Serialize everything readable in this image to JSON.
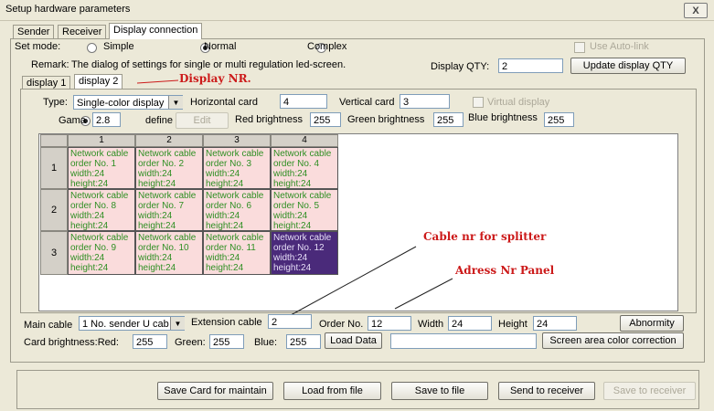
{
  "window": {
    "title": "Setup hardware parameters",
    "close": "X"
  },
  "tabs": [
    {
      "label": "Sender"
    },
    {
      "label": "Receiver"
    },
    {
      "label": "Display connection"
    }
  ],
  "set_mode": {
    "label": "Set mode:",
    "options": [
      {
        "label": "Simple",
        "selected": false
      },
      {
        "label": "Normal",
        "selected": true
      },
      {
        "label": "Complex",
        "selected": false
      }
    ],
    "auto_link": "Use Auto-link"
  },
  "remark": {
    "label": "Remark:",
    "text": "The dialog of settings for single or multi  regulation led-screen."
  },
  "display_qty": {
    "label": "Display QTY:",
    "value": "2",
    "update_button": "Update display QTY"
  },
  "display_tabs": [
    {
      "label": "display 1"
    },
    {
      "label": "display 2"
    }
  ],
  "config": {
    "type_label": "Type:",
    "type_value": "Single-color display",
    "horizontal_label": "Horizontal card",
    "horizontal_value": "4",
    "vertical_label": "Vertical card",
    "vertical_value": "3",
    "virtual_label": "Virtual display",
    "gama_label": "Gama",
    "gama_value": "2.8",
    "define_label": "define",
    "edit_label": "Edit",
    "red_label": "Red brightness",
    "red_value": "255",
    "green_label": "Green brightness",
    "green_value": "255",
    "blue_label": "Blue brightness",
    "blue_value": "255"
  },
  "grid": {
    "col_headers": [
      "1",
      "2",
      "3",
      "4"
    ],
    "row_headers": [
      "1",
      "2",
      "3"
    ],
    "rows": [
      [
        [
          "Network cable",
          "order No. 1",
          "width:24",
          "height:24"
        ],
        [
          "Network cable",
          "order No. 2",
          "width:24",
          "height:24"
        ],
        [
          "Network cable",
          "order No. 3",
          "width:24",
          "height:24"
        ],
        [
          "Network cable",
          "order No. 4",
          "width:24",
          "height:24"
        ]
      ],
      [
        [
          "Network cable",
          "order No. 8",
          "width:24",
          "height:24"
        ],
        [
          "Network cable",
          "order No. 7",
          "width:24",
          "height:24"
        ],
        [
          "Network cable",
          "order No. 6",
          "width:24",
          "height:24"
        ],
        [
          "Network cable",
          "order No. 5",
          "width:24",
          "height:24"
        ]
      ],
      [
        [
          "Network cable",
          "order No. 9",
          "width:24",
          "height:24"
        ],
        [
          "Network cable",
          "order No. 10",
          "width:24",
          "height:24"
        ],
        [
          "Network cable",
          "order No. 11",
          "width:24",
          "height:24"
        ],
        [
          "Network cable",
          "order No. 12",
          "width:24",
          "height:24"
        ]
      ]
    ]
  },
  "annotations": {
    "display_nr": "Display NR.",
    "cable_nr": "Cable nr for splitter",
    "adress_nr": "Adress Nr Panel"
  },
  "cable": {
    "main_label": "Main cable",
    "main_value": "1 No. sender U cab",
    "extension_label": "Extension cable",
    "extension_value": "2",
    "order_label": "Order No.",
    "order_value": "12",
    "width_label": "Width",
    "width_value": "24",
    "height_label": "Height",
    "height_value": "24",
    "abnormity_button": "Abnormity"
  },
  "card_brightness": {
    "red_label": "Card brightness:Red:",
    "red_value": "255",
    "green_label": "Green:",
    "green_value": "255",
    "blue_label": "Blue:",
    "blue_value": "255",
    "load_button": "Load Data",
    "path_value": "",
    "correction_button": "Screen area color correction"
  },
  "footer_buttons": {
    "save_card": "Save Card for maintain",
    "load": "Load from file",
    "save": "Save to file",
    "send": "Send to receiver",
    "save_receiver": "Save to receiver"
  }
}
